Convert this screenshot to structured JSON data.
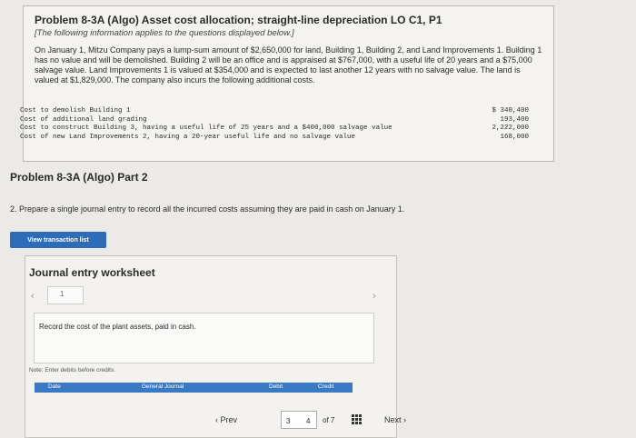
{
  "problem": {
    "title": "Problem 8-3A (Algo) Asset cost allocation; straight-line depreciation LO C1, P1",
    "subtitle": "[The following information applies to the questions displayed below.]",
    "paragraph": "On January 1, Mitzu Company pays a lump-sum amount of $2,650,000 for land, Building 1, Building 2, and Land Improvements 1. Building 1 has no value and will be demolished. Building 2 will be an office and is appraised at $767,000, with a useful life of 20 years and a $75,000 salvage value. Land Improvements 1 is valued at $354,000 and is expected to last another 12 years with no salvage value. The land is valued at $1,829,000. The company also incurs the following additional costs.",
    "costs": [
      {
        "label": "Cost to demolish Building 1",
        "value": "$ 340,400"
      },
      {
        "label": "Cost of additional land grading",
        "value": "193,400"
      },
      {
        "label": "Cost to construct Building 3, having a useful life of 25 years and a $400,000 salvage value",
        "value": "2,222,000"
      },
      {
        "label": "Cost of new Land Improvements 2, having a 20-year useful life and no salvage value",
        "value": "168,000"
      }
    ]
  },
  "part": {
    "title": "Problem 8-3A (Algo) Part 2",
    "question": "2. Prepare a single journal entry to record all the incurred costs assuming they are paid in cash on January 1."
  },
  "buttons": {
    "view_transactions": "View transaction list"
  },
  "worksheet": {
    "title": "Journal entry worksheet",
    "current_entry": "1",
    "instruction": "Record the cost of the plant assets, paid in cash.",
    "note": "Note: Enter debits before credits.",
    "columns": [
      "Date",
      "General Journal",
      "Debit",
      "Credit"
    ]
  },
  "pager": {
    "prev": "Prev",
    "current": "3",
    "next_num": "4",
    "of": "of 7",
    "next": "Next"
  }
}
